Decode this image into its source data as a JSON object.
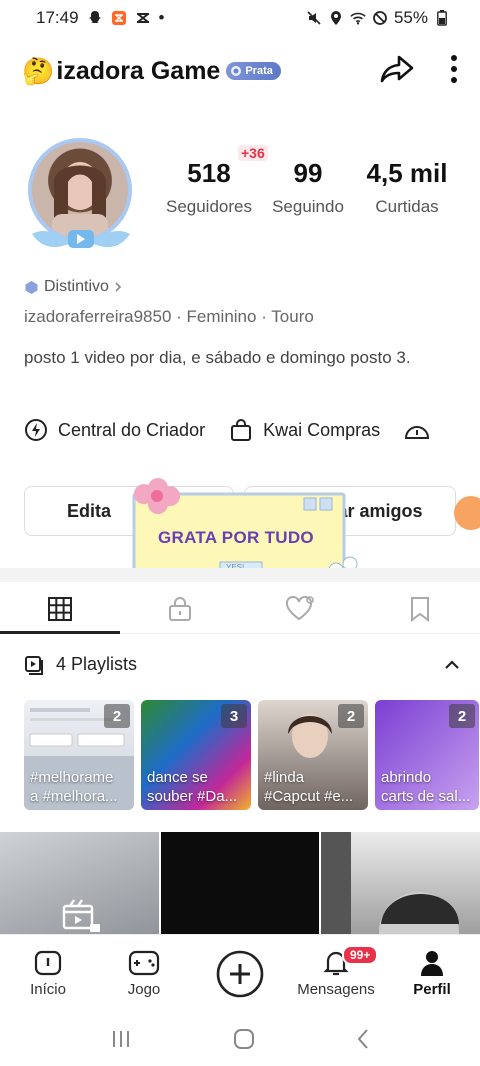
{
  "status_bar": {
    "time": "17:49",
    "dot": "•",
    "battery": "55%"
  },
  "profile": {
    "emoji": "🤔",
    "name": "izadora Game",
    "badge": "Prata",
    "stats": [
      {
        "value": "518",
        "label": "Seguidores"
      },
      {
        "value": "99",
        "label": "Seguindo"
      },
      {
        "value": "4,5 mil",
        "label": "Curtidas"
      }
    ],
    "new_followers": "+36",
    "distintivo": "Distintivo",
    "username": "izadoraferreira9850",
    "gender": "Feminino",
    "sign": "Touro",
    "bio": "posto 1 video por dia, e sábado e domingo posto 3."
  },
  "quick_links": [
    {
      "label": "Central do Criador",
      "icon": "creator-icon"
    },
    {
      "label": "Kwai Compras",
      "icon": "shopping-bag-icon"
    }
  ],
  "buttons": {
    "edit": "Edita",
    "add_friends": "ar amigos"
  },
  "sticker": {
    "text": "GRATA POR TUDO",
    "small": "YES!"
  },
  "playlists": {
    "header": "4 Playlists",
    "items": [
      {
        "count": "2",
        "text": "#melhorame\na #melhora...",
        "colors": [
          "#e9edf3",
          "#c9cfd8"
        ]
      },
      {
        "count": "3",
        "text": "dance se\nsouber #Da...",
        "colors": [
          "#3a8f2f",
          "#c2289a"
        ]
      },
      {
        "count": "2",
        "text": "#linda\n#Capcut #e...",
        "colors": [
          "#d8cfc7",
          "#5f5551"
        ]
      },
      {
        "count": "2",
        "text": "abrindo\ncarts de sal...",
        "colors": [
          "#8a4fd8",
          "#c9a3ef"
        ]
      }
    ]
  },
  "nav": {
    "items": [
      {
        "label": "Início",
        "icon": "home-icon"
      },
      {
        "label": "Jogo",
        "icon": "gamepad-icon"
      },
      {
        "label": "",
        "icon": "create-plus-icon"
      },
      {
        "label": "Mensagens",
        "icon": "bell-icon",
        "badge": "99+"
      },
      {
        "label": "Perfil",
        "icon": "person-icon"
      }
    ]
  }
}
